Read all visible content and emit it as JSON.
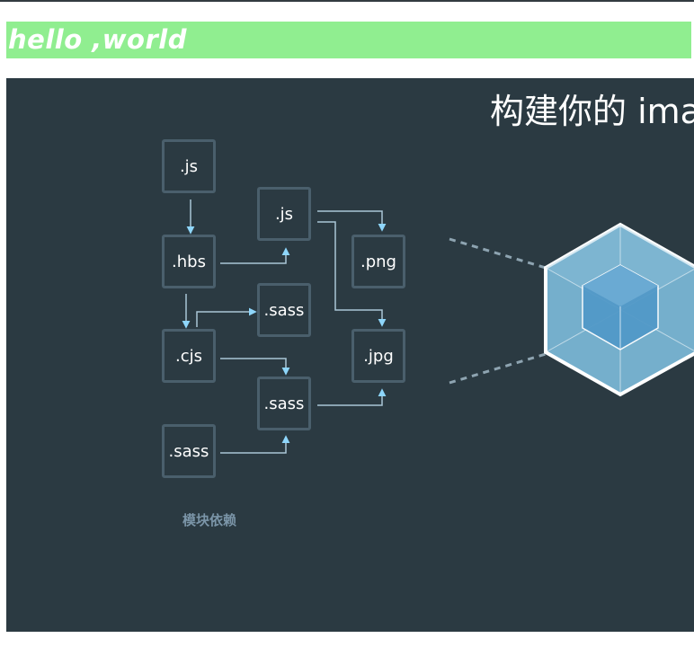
{
  "banner": {
    "text": "hello ,world"
  },
  "hero": {
    "headline": "构建你的 ima",
    "modules": [
      ".js",
      ".js",
      ".hbs",
      ".png",
      ".sass",
      ".cjs",
      ".jpg",
      ".sass",
      ".sass"
    ],
    "caption": "模块依赖"
  },
  "colors": {
    "banner_bg": "#90ee90",
    "stage_bg": "#2b3a42",
    "box_border": "#4a5f6c",
    "arrow": "#8ed6fb",
    "cube_outer": "#75afcc",
    "cube_inner": "#5299c8"
  }
}
